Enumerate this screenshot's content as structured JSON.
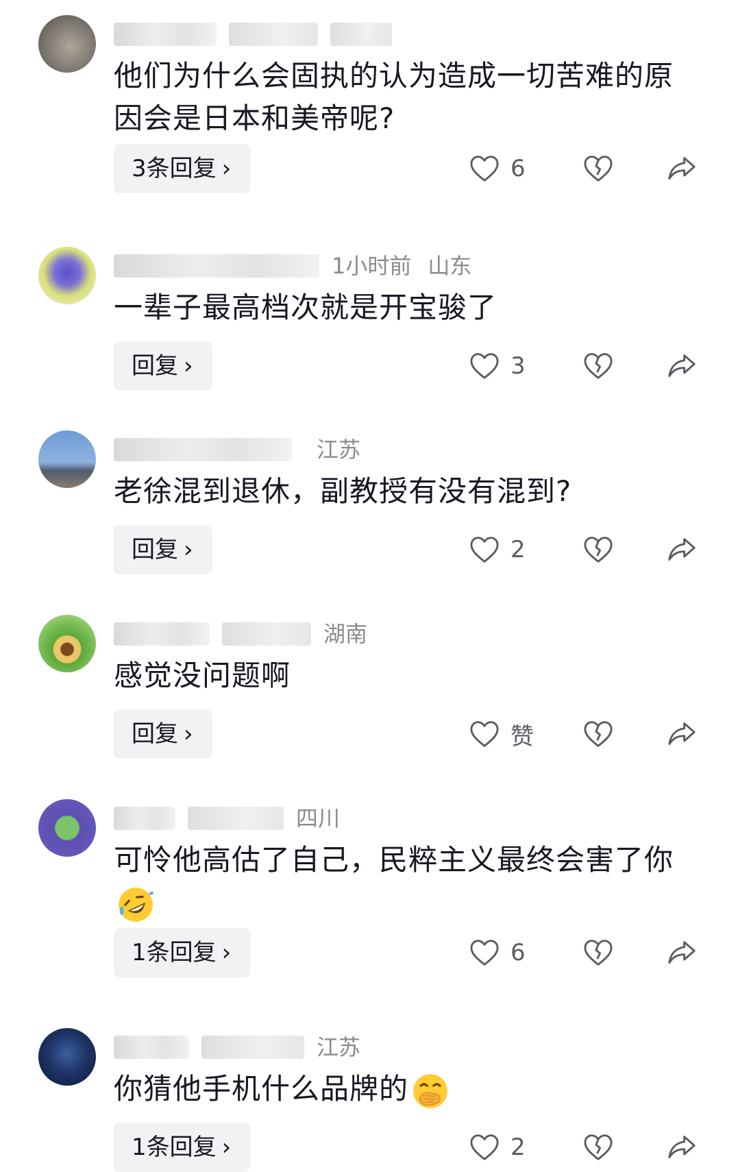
{
  "comments": [
    {
      "time": "",
      "location": "",
      "text": "他们为什么会固执的认为造成一切苦难的原因会是日本和美帝呢?",
      "reply_label": "3条回复",
      "like_count": "6",
      "avatar_color": "#9b9893"
    },
    {
      "time": "1小时前",
      "location": "山东",
      "text": "一辈子最高档次就是开宝骏了",
      "reply_label": "回复",
      "like_count": "3",
      "avatar_color": "#c9c2e8"
    },
    {
      "time": "",
      "location": "江苏",
      "text": "老徐混到退休，副教授有没有混到?",
      "reply_label": "回复",
      "like_count": "2",
      "avatar_color": "#7da4d6"
    },
    {
      "time": "",
      "location": "湖南",
      "text": "感觉没问题啊",
      "reply_label": "回复",
      "like_count": "赞",
      "avatar_color": "#7cbf58"
    },
    {
      "time": "",
      "location": "四川",
      "text": "可怜他高估了自己，民粹主义最终会害了你",
      "reply_label": "1条回复",
      "like_count": "6",
      "avatar_color": "#5d4fb0"
    },
    {
      "time": "",
      "location": "江苏",
      "text": "你猜他手机什么品牌的",
      "reply_label": "1条回复",
      "like_count": "2",
      "avatar_color": "#1f3468"
    }
  ],
  "icons": {
    "like": "heart-outline-icon",
    "dislike": "broken-heart-icon",
    "share": "share-arrow-icon",
    "chevron": "chevron-right-icon"
  },
  "colors": {
    "text": "#161823",
    "meta": "#8a8b91",
    "pill_bg": "#f2f2f4"
  }
}
